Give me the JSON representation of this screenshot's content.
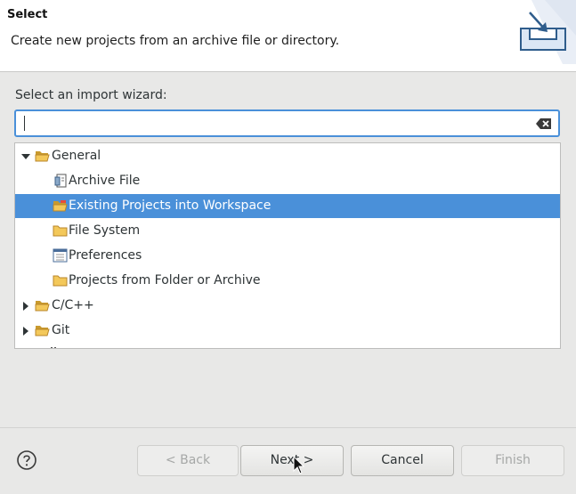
{
  "header": {
    "title": "Select",
    "description": "Create new projects from an archive file or directory."
  },
  "filter": {
    "label": "Select an import wizard:",
    "value": ""
  },
  "tree": {
    "groups": [
      {
        "label": "General",
        "expanded": true,
        "children": [
          {
            "label": "Archive File",
            "icon": "archive-file-icon"
          },
          {
            "label": "Existing Projects into Workspace",
            "icon": "folder-projects-icon",
            "selected": true
          },
          {
            "label": "File System",
            "icon": "folder-icon"
          },
          {
            "label": "Preferences",
            "icon": "preferences-icon"
          },
          {
            "label": "Projects from Folder or Archive",
            "icon": "folder-icon"
          }
        ]
      },
      {
        "label": "C/C++",
        "expanded": false
      },
      {
        "label": "Git",
        "expanded": false
      }
    ]
  },
  "buttons": {
    "back": "< Back",
    "next": "Next >",
    "cancel": "Cancel",
    "finish": "Finish"
  },
  "colors": {
    "selection": "#4a90d9",
    "focus_border": "#4a90d9"
  }
}
